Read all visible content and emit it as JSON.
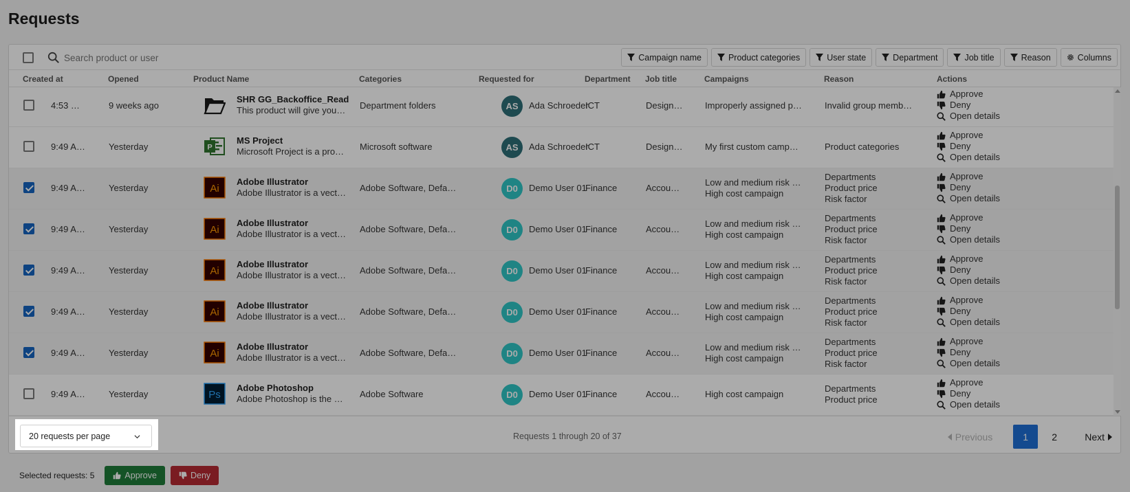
{
  "page": {
    "title": "Requests"
  },
  "toolbar": {
    "search_placeholder": "Search product or user",
    "filters": [
      "Campaign name",
      "Product categories",
      "User state",
      "Department",
      "Job title",
      "Reason"
    ],
    "columns_label": "Columns"
  },
  "columns": [
    "Created at",
    "Opened",
    "Product Name",
    "Categories",
    "Requested for",
    "Department",
    "Job title",
    "Campaigns",
    "Reason",
    "Actions"
  ],
  "actions": {
    "approve": "Approve",
    "deny": "Deny",
    "open_details": "Open details"
  },
  "rows": [
    {
      "checked": false,
      "created": "4:53 P…",
      "opened": "9 weeks ago",
      "product": "SHR GG_Backoffice_Read",
      "description": "This product will give you…",
      "icon": "folder-icon",
      "category": "Department folders",
      "initials": "AS",
      "avatar_color": "#2e6f78",
      "user": "Ada Schroeder",
      "department": "ICT",
      "job": "Design…",
      "campaigns": [
        "Improperly assigned p…"
      ],
      "reasons": [
        "Invalid group memb…"
      ]
    },
    {
      "checked": false,
      "created": "9:49 A…",
      "opened": "Yesterday",
      "product": "MS Project",
      "description": "Microsoft Project is a pro…",
      "icon": "ms-project-icon",
      "category": "Microsoft software",
      "initials": "AS",
      "avatar_color": "#2e6f78",
      "user": "Ada Schroeder",
      "department": "ICT",
      "job": "Design…",
      "campaigns": [
        "My first custom camp…"
      ],
      "reasons": [
        "Product categories"
      ]
    },
    {
      "checked": true,
      "created": "9:49 A…",
      "opened": "Yesterday",
      "product": "Adobe Illustrator",
      "description": "Adobe Illustrator is a vect…",
      "icon": "illustrator-icon",
      "category": "Adobe Software, Defa…",
      "initials": "D0",
      "avatar_color": "#2fc5c5",
      "user": "Demo User 01",
      "department": "Finance",
      "job": "Accou…",
      "campaigns": [
        "Low and medium risk …",
        "High cost campaign"
      ],
      "reasons": [
        "Departments",
        "Product price",
        "Risk factor"
      ]
    },
    {
      "checked": true,
      "created": "9:49 A…",
      "opened": "Yesterday",
      "product": "Adobe Illustrator",
      "description": "Adobe Illustrator is a vect…",
      "icon": "illustrator-icon",
      "category": "Adobe Software, Defa…",
      "initials": "D0",
      "avatar_color": "#2fc5c5",
      "user": "Demo User 01",
      "department": "Finance",
      "job": "Accou…",
      "campaigns": [
        "Low and medium risk …",
        "High cost campaign"
      ],
      "reasons": [
        "Departments",
        "Product price",
        "Risk factor"
      ]
    },
    {
      "checked": true,
      "created": "9:49 A…",
      "opened": "Yesterday",
      "product": "Adobe Illustrator",
      "description": "Adobe Illustrator is a vect…",
      "icon": "illustrator-icon",
      "category": "Adobe Software, Defa…",
      "initials": "D0",
      "avatar_color": "#2fc5c5",
      "user": "Demo User 01",
      "department": "Finance",
      "job": "Accou…",
      "campaigns": [
        "Low and medium risk …",
        "High cost campaign"
      ],
      "reasons": [
        "Departments",
        "Product price",
        "Risk factor"
      ]
    },
    {
      "checked": true,
      "created": "9:49 A…",
      "opened": "Yesterday",
      "product": "Adobe Illustrator",
      "description": "Adobe Illustrator is a vect…",
      "icon": "illustrator-icon",
      "category": "Adobe Software, Defa…",
      "initials": "D0",
      "avatar_color": "#2fc5c5",
      "user": "Demo User 01",
      "department": "Finance",
      "job": "Accou…",
      "campaigns": [
        "Low and medium risk …",
        "High cost campaign"
      ],
      "reasons": [
        "Departments",
        "Product price",
        "Risk factor"
      ]
    },
    {
      "checked": true,
      "created": "9:49 A…",
      "opened": "Yesterday",
      "product": "Adobe Illustrator",
      "description": "Adobe Illustrator is a vect…",
      "icon": "illustrator-icon",
      "category": "Adobe Software, Defa…",
      "initials": "D0",
      "avatar_color": "#2fc5c5",
      "user": "Demo User 01",
      "department": "Finance",
      "job": "Accou…",
      "campaigns": [
        "Low and medium risk …",
        "High cost campaign"
      ],
      "reasons": [
        "Departments",
        "Product price",
        "Risk factor"
      ]
    },
    {
      "checked": false,
      "created": "9:49 A…",
      "opened": "Yesterday",
      "product": "Adobe Photoshop",
      "description": "Adobe Photoshop is the …",
      "icon": "photoshop-icon",
      "category": "Adobe Software",
      "initials": "D0",
      "avatar_color": "#2fc5c5",
      "user": "Demo User 01",
      "department": "Finance",
      "job": "Accou…",
      "campaigns": [
        "High cost campaign"
      ],
      "reasons": [
        "Departments",
        "Product price"
      ]
    }
  ],
  "footer": {
    "per_page": "20 requests per page",
    "summary": "Requests 1 through 20 of 37",
    "previous": "Previous",
    "pages": [
      "1",
      "2"
    ],
    "current_page": "1",
    "next": "Next"
  },
  "bulk": {
    "selected_label": "Selected requests: 5",
    "approve": "Approve",
    "deny": "Deny"
  },
  "colors": {
    "primary": "#1f6fd6",
    "approve": "#1e7d3a",
    "deny": "#b62b34",
    "checkbox": "#1565c0"
  }
}
